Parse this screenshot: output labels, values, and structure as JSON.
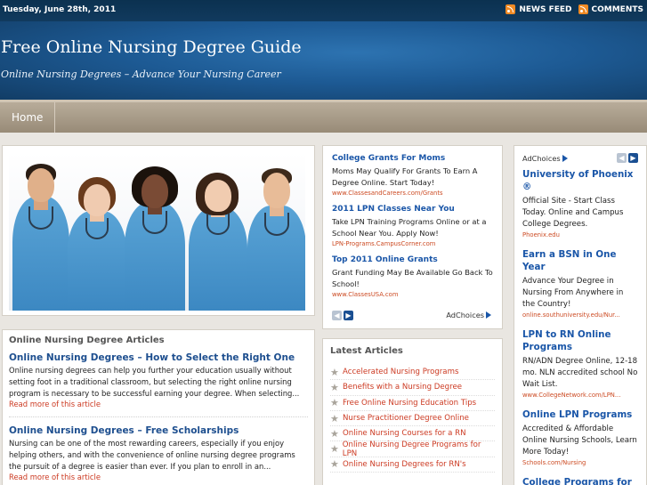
{
  "topbar": {
    "date": "Tuesday, June 28th, 2011",
    "news_feed": "NEWS FEED",
    "comments": "COMMENTS"
  },
  "header": {
    "title": "Free Online Nursing Degree Guide",
    "tagline": "Online Nursing Degrees – Advance Your Nursing Career"
  },
  "nav": {
    "home": "Home"
  },
  "articles": {
    "heading": "Online Nursing Degree Articles",
    "items": [
      {
        "title": "Online Nursing Degrees – How to Select the Right One",
        "body": "Online nursing degrees can help you further your education usually without setting foot in a traditional classroom, but selecting the right online nursing program is necessary to be successful earning your degree. When selecting...",
        "more": "Read more of this article"
      },
      {
        "title": "Online Nursing Degrees – Free Scholarships",
        "body": "Nursing can be one of the most rewarding careers, especially if you enjoy helping others, and with the convenience of online nursing degree programs the pursuit of a degree is easier than ever. If you plan to enroll in an...",
        "more": "Read more of this article"
      }
    ]
  },
  "mid_ads": {
    "items": [
      {
        "title": "College Grants For Moms",
        "body": "Moms May Qualify For Grants To Earn A Degree Online. Start Today!",
        "url": "www.ClassesandCareers.com/Grants"
      },
      {
        "title": "2011 LPN Classes Near You",
        "body": "Take LPN Training Programs Online or at a School Near You. Apply Now!",
        "url": "LPN-Programs.CampusCorner.com"
      },
      {
        "title": "Top 2011 Online Grants",
        "body": "Grant Funding May Be Available Go Back To School!",
        "url": "www.ClassesUSA.com"
      }
    ],
    "adchoices": "AdChoices"
  },
  "latest": {
    "heading": "Latest Articles",
    "items": [
      "Accelerated Nursing Programs",
      "Benefits with a Nursing Degree",
      "Free Online Nursing Education Tips",
      "Nurse Practitioner Degree Online",
      "Online Nursing Courses for a RN",
      "Online Nursing Degree Programs for LPN",
      "Online Nursing Degrees for RN's"
    ]
  },
  "right_ads": {
    "adchoices": "AdChoices",
    "items": [
      {
        "title": "University of Phoenix ®",
        "body": "Official Site - Start Class Today. Online and Campus College Degrees.",
        "url": "Phoenix.edu"
      },
      {
        "title": "Earn a BSN in One Year",
        "body": "Advance Your Degree in Nursing From Anywhere in the Country!",
        "url": "online.southuniversity.edu/Nur..."
      },
      {
        "title": "LPN to RN Online Programs",
        "body": "RN/ADN Degree Online, 12-18 mo. NLN accredited school No Wait List.",
        "url": "www.CollegeNetwork.com/LPN..."
      },
      {
        "title": "Online LPN Programs",
        "body": "Accredited & Affordable Online Nursing Schools, Learn More Today!",
        "url": "Schools.com/Nursing"
      },
      {
        "title": "College Programs for",
        "body": "",
        "url": ""
      }
    ]
  },
  "colors": {
    "header_blue": "#1d5a94",
    "link_blue": "#1e4f8f",
    "link_red": "#cc3a22",
    "nav_tan": "#a89c88"
  },
  "icons": {
    "feed": "rss-icon",
    "article_bullet": "star-icon",
    "ad_prev": "chevron-left-icon",
    "ad_next": "chevron-right-icon"
  }
}
